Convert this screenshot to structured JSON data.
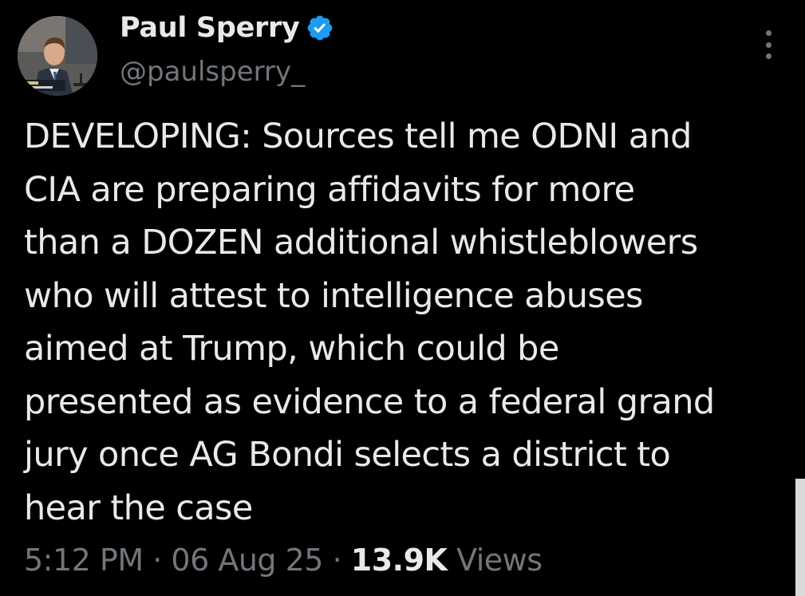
{
  "author": {
    "display_name": "Paul Sperry",
    "handle": "@paulsperry_",
    "verified_color": "#1d9bf0",
    "avatar_icon": "profile-photo"
  },
  "menu": {
    "icon": "more-vertical-icon"
  },
  "tweet": {
    "lines": [
      "DEVELOPING: Sources tell me ODNI and",
      "CIA are preparing affidavits for more",
      "than a DOZEN additional whistleblowers",
      "who will attest to intelligence abuses",
      "aimed at Trump, which could be",
      "presented as evidence to a federal grand",
      "jury once AG Bondi selects a district to",
      "hear the case"
    ]
  },
  "meta": {
    "time": "5:12 PM",
    "separator": "·",
    "date": "06 Aug 25",
    "views_count": "13.9K",
    "views_label": "Views"
  },
  "colors": {
    "background": "#000000",
    "primary_text": "#e7e9ea",
    "secondary_text": "#71767b"
  }
}
